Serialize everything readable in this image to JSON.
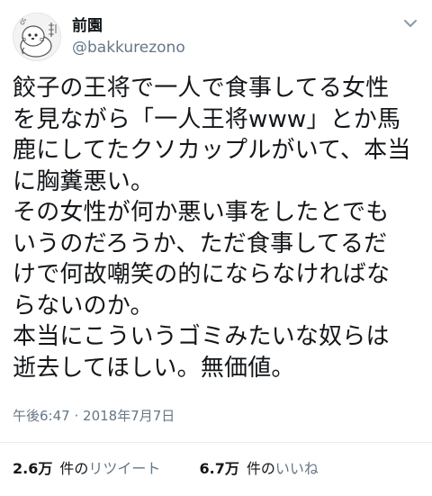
{
  "author": {
    "display_name": "前園",
    "handle": "@bakkurezono",
    "avatar_icon": "seal-mascot-avatar"
  },
  "header": {
    "menu_icon": "chevron-down-icon"
  },
  "tweet": {
    "lines": [
      "餃子の王将で一人で食事してる女性",
      "を見ながら「一人王将www」とか馬",
      "鹿にしてたクソカップルがいて、本当",
      "に胸糞悪い。",
      "その女性が何か悪い事をしたとでも",
      "いうのだろうか、ただ食事してるだ",
      "けで何故嘲笑の的にならなければな",
      "らないのか。",
      "本当にこういうゴミみたいな奴らは",
      "逝去してほしい。無価値。"
    ]
  },
  "meta": {
    "time": "午後6:47",
    "separator": "·",
    "date": "2018年7月7日"
  },
  "stats": {
    "retweets": {
      "count": "2.6万",
      "label_prefix": "件の",
      "label_suffix": "リツイート"
    },
    "likes": {
      "count": "6.7万",
      "label_prefix": "件の",
      "label_suffix": "いいね"
    }
  },
  "colors": {
    "text": "#14171a",
    "secondary": "#657786",
    "divider": "#e6ecf0",
    "background": "#ffffff"
  }
}
